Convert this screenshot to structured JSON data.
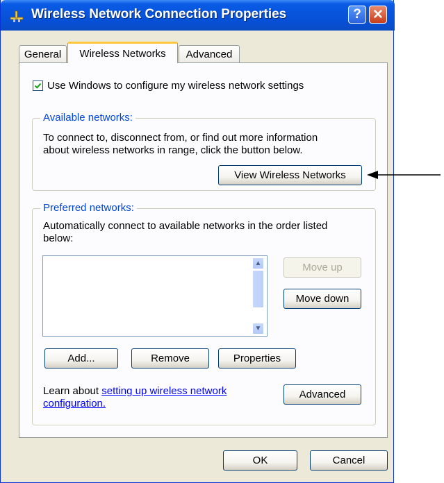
{
  "window": {
    "title": "Wireless Network Connection Properties",
    "help_symbol": "?",
    "close_symbol": "✕"
  },
  "tabs": [
    {
      "label": "General",
      "active": false
    },
    {
      "label": "Wireless Networks",
      "active": true
    },
    {
      "label": "Advanced",
      "active": false
    }
  ],
  "use_windows_checkbox": {
    "label": "Use Windows to configure my wireless network settings",
    "checked": true
  },
  "available_networks": {
    "legend": "Available networks:",
    "description_line1": "To connect to, disconnect from, or find out more information",
    "description_line2": "about wireless networks in range, click the button below.",
    "view_button": "View Wireless Networks"
  },
  "preferred_networks": {
    "legend": "Preferred networks:",
    "description_line1": "Automatically connect to available networks in the order listed",
    "description_line2": "below:",
    "items": [],
    "move_up": "Move up",
    "move_down": "Move down",
    "add": "Add...",
    "remove": "Remove",
    "properties": "Properties",
    "learn_prefix": "Learn about ",
    "learn_link_line1": "setting up wireless network",
    "learn_link_line2": "configuration.",
    "advanced": "Advanced"
  },
  "footer": {
    "ok": "OK",
    "cancel": "Cancel"
  },
  "colors": {
    "titlebar": "#0855dd",
    "legend_text": "#0046d5",
    "active_tab_highlight": "#ffc83c",
    "link": "#0000ff"
  },
  "icons": [
    "network-connection-icon",
    "help-icon",
    "close-icon",
    "check-icon",
    "scroll-up-icon",
    "scroll-down-icon",
    "arrow-icon"
  ]
}
